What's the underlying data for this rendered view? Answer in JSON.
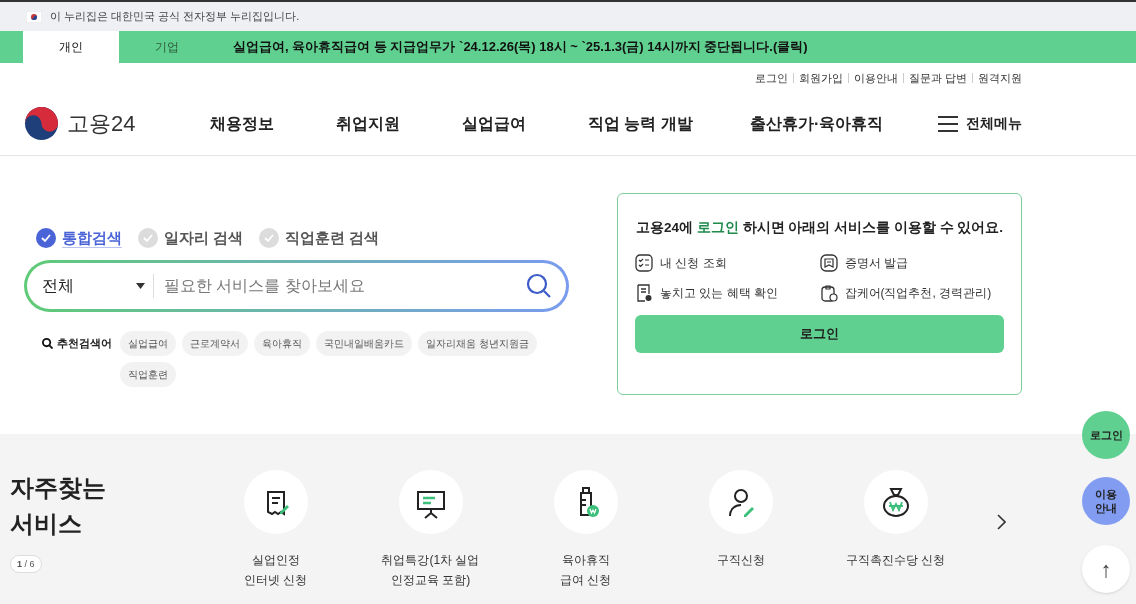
{
  "gov_banner": {
    "text": "이 누리집은 대한민국 공식 전자정부 누리집입니다."
  },
  "audience_tabs": [
    {
      "label": "개인",
      "selected": true
    },
    {
      "label": "기업",
      "selected": false
    }
  ],
  "notice": "실업급여, 육아휴직급여 등 지급업무가 `24.12.26(목) 18시 ~ `25.1.3(금) 14시까지 중단됩니다.(클릭)",
  "utility_links": [
    "로그인",
    "회원가입",
    "이용안내",
    "질문과 답변",
    "원격지원"
  ],
  "logo": {
    "text": "고용24"
  },
  "nav": [
    "채용정보",
    "취업지원",
    "실업급여",
    "직업 능력 개발",
    "출산휴가·육아휴직"
  ],
  "all_menu": "전체메뉴",
  "search_types": [
    {
      "label": "통합검색",
      "selected": true
    },
    {
      "label": "일자리 검색",
      "selected": false
    },
    {
      "label": "직업훈련 검색",
      "selected": false
    }
  ],
  "search": {
    "category": "전체",
    "placeholder": "필요한 서비스를 찾아보세요"
  },
  "recommended": {
    "label": "추천검색어",
    "keywords": [
      "실업급여",
      "근로계약서",
      "육아휴직",
      "국민내일배움카드",
      "일자리채움 청년지원금",
      "직업훈련"
    ]
  },
  "login_card": {
    "message": "고용24에 **로그인** 하시면 아래의 서비스를 이용할 수 있어요.",
    "services": [
      {
        "kind": "list",
        "label": "내 신청 조회"
      },
      {
        "kind": "certificate",
        "label": "증명서 발급"
      },
      {
        "kind": "benefit",
        "label": "놓치고 있는 혜택 확인"
      },
      {
        "kind": "jobcare",
        "label": "잡케어(직업추천, 경력관리)"
      }
    ],
    "button": "로그인"
  },
  "frequent_services": {
    "title": "자주찾는 서비스",
    "page_indicator": "**1** / 6",
    "items": [
      {
        "kind": "receipt",
        "label": "실업인정\n인터넷 신청"
      },
      {
        "kind": "lecture",
        "label": "취업특강(1차 실업\n인정교육 포함)"
      },
      {
        "kind": "bottle",
        "label": "육아휴직\n급여 신청"
      },
      {
        "kind": "person",
        "label": "구직신청"
      },
      {
        "kind": "moneybag",
        "label": "구직촉진수당 신청"
      }
    ]
  },
  "floating": {
    "login": "로그인",
    "guide": "이용\n안내",
    "top": "↑"
  }
}
